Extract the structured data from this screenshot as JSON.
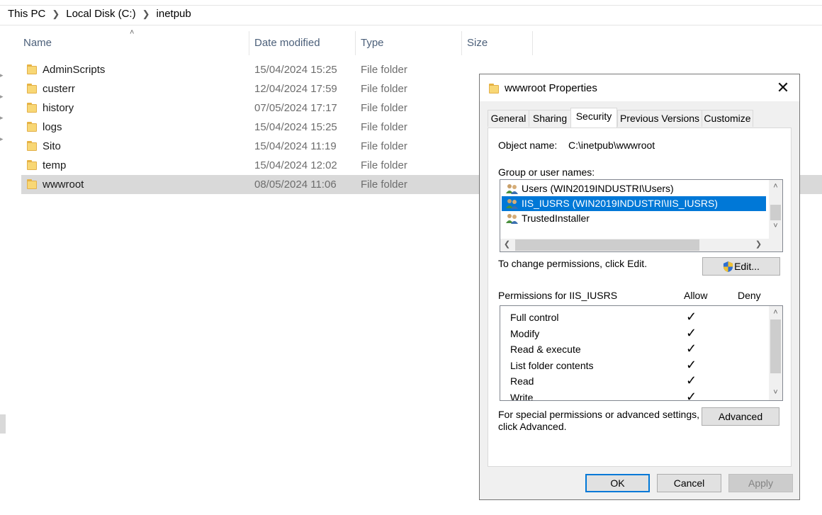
{
  "explorer": {
    "breadcrumb": [
      "This PC",
      "Local Disk (C:)",
      "inetpub"
    ],
    "columns": {
      "name": "Name",
      "date": "Date modified",
      "type": "Type",
      "size": "Size"
    },
    "rows": [
      {
        "name": "AdminScripts",
        "date": "15/04/2024 15:25",
        "type": "File folder"
      },
      {
        "name": "custerr",
        "date": "12/04/2024 17:59",
        "type": "File folder"
      },
      {
        "name": "history",
        "date": "07/05/2024 17:17",
        "type": "File folder"
      },
      {
        "name": "logs",
        "date": "15/04/2024 15:25",
        "type": "File folder"
      },
      {
        "name": "Sito",
        "date": "15/04/2024 11:19",
        "type": "File folder"
      },
      {
        "name": "temp",
        "date": "15/04/2024 12:02",
        "type": "File folder"
      },
      {
        "name": "wwwroot",
        "date": "08/05/2024 11:06",
        "type": "File folder",
        "selected": true
      }
    ]
  },
  "dialog": {
    "title": "wwwroot Properties",
    "close_icon": "close-icon",
    "tabs": [
      "General",
      "Sharing",
      "Security",
      "Previous Versions",
      "Customize"
    ],
    "active_tab": "Security",
    "object_name_label": "Object name:",
    "object_name_value": "C:\\inetpub\\wwwroot",
    "group_label": "Group or user names:",
    "users": [
      {
        "name": "Users (WIN2019INDUSTRI\\Users)",
        "icon": "users-group-icon"
      },
      {
        "name": "IIS_IUSRS (WIN2019INDUSTRI\\IIS_IUSRS)",
        "icon": "users-group-icon",
        "selected": true
      },
      {
        "name": "TrustedInstaller",
        "icon": "users-group-icon"
      }
    ],
    "change_text": "To change permissions, click Edit.",
    "edit_button": "Edit...",
    "edit_icon": "uac-shield-icon",
    "perms_label": "Permissions for IIS_IUSRS",
    "allow_label": "Allow",
    "deny_label": "Deny",
    "permissions": [
      {
        "name": "Full control",
        "allow": true,
        "deny": false
      },
      {
        "name": "Modify",
        "allow": true,
        "deny": false
      },
      {
        "name": "Read & execute",
        "allow": true,
        "deny": false
      },
      {
        "name": "List folder contents",
        "allow": true,
        "deny": false
      },
      {
        "name": "Read",
        "allow": true,
        "deny": false
      },
      {
        "name": "Write",
        "allow": true,
        "deny": false
      }
    ],
    "check_glyph": "✓",
    "special_text_1": "For special permissions or advanced settings,",
    "special_text_2": "click Advanced.",
    "advanced_button": "Advanced",
    "ok_button": "OK",
    "cancel_button": "Cancel",
    "apply_button": "Apply"
  },
  "colors": {
    "accent": "#0078d7",
    "selection_row": "#d9d9d9",
    "folder": "#f8d775"
  }
}
